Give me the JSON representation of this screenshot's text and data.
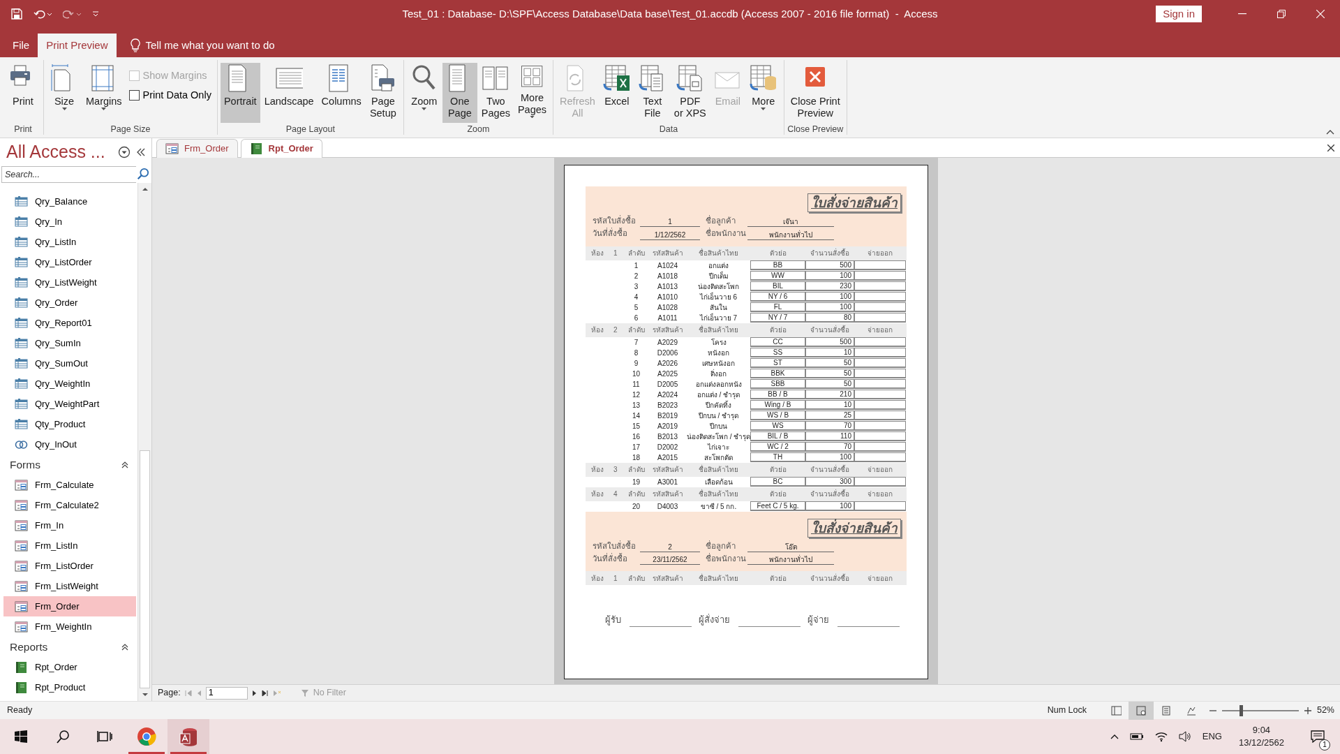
{
  "title_bar": {
    "title": "Test_01 : Database- D:\\SPF\\Access Database\\Data base\\Test_01.accdb (Access 2007 - 2016 file format)  -  Access",
    "sign_in": "Sign in"
  },
  "menu_tabs": [
    {
      "label": "File",
      "selected": false
    },
    {
      "label": "Print Preview",
      "selected": true
    }
  ],
  "tell_me": "Tell me what you want to do",
  "ribbon": {
    "groups": [
      {
        "label": "Print",
        "controls": [
          {
            "kind": "large",
            "label": "Print",
            "dropdown": false,
            "selected": false,
            "disabled": false
          }
        ]
      },
      {
        "label": "Page Size",
        "controls": [
          {
            "kind": "large",
            "label": "Size",
            "dropdown": true,
            "selected": false,
            "disabled": false
          },
          {
            "kind": "large",
            "label": "Margins",
            "dropdown": true,
            "selected": false,
            "disabled": false
          },
          {
            "kind": "check",
            "label": "Show Margins",
            "checked": false,
            "disabled": true
          },
          {
            "kind": "check",
            "label": "Print Data Only",
            "checked": false,
            "disabled": false
          }
        ]
      },
      {
        "label": "Page Layout",
        "controls": [
          {
            "kind": "large",
            "label": "Portrait",
            "dropdown": false,
            "selected": true,
            "disabled": false
          },
          {
            "kind": "large",
            "label": "Landscape",
            "dropdown": false,
            "selected": false,
            "disabled": false
          },
          {
            "kind": "large",
            "label": "Columns",
            "dropdown": false,
            "selected": false,
            "disabled": false
          },
          {
            "kind": "large",
            "label": "Page\nSetup",
            "dropdown": false,
            "selected": false,
            "disabled": false
          }
        ]
      },
      {
        "label": "Zoom",
        "controls": [
          {
            "kind": "large",
            "label": "Zoom",
            "dropdown": true,
            "selected": false,
            "disabled": false
          },
          {
            "kind": "large",
            "label": "One\nPage",
            "dropdown": false,
            "selected": true,
            "disabled": false
          },
          {
            "kind": "large",
            "label": "Two\nPages",
            "dropdown": false,
            "selected": false,
            "disabled": false
          },
          {
            "kind": "large",
            "label": "More\nPages",
            "dropdown": true,
            "selected": false,
            "disabled": false
          }
        ]
      },
      {
        "label": "Data",
        "controls": [
          {
            "kind": "large",
            "label": "Refresh\nAll",
            "dropdown": false,
            "selected": false,
            "disabled": true
          },
          {
            "kind": "large",
            "label": "Excel",
            "dropdown": false,
            "selected": false,
            "disabled": false
          },
          {
            "kind": "large",
            "label": "Text\nFile",
            "dropdown": false,
            "selected": false,
            "disabled": false
          },
          {
            "kind": "large",
            "label": "PDF\nor XPS",
            "dropdown": false,
            "selected": false,
            "disabled": false
          },
          {
            "kind": "large",
            "label": "Email",
            "dropdown": false,
            "selected": false,
            "disabled": true
          },
          {
            "kind": "large",
            "label": "More",
            "dropdown": true,
            "selected": false,
            "disabled": false
          }
        ]
      },
      {
        "label": "Close Preview",
        "controls": [
          {
            "kind": "large",
            "label": "Close Print\nPreview",
            "dropdown": false,
            "selected": false,
            "disabled": false
          }
        ]
      }
    ]
  },
  "nav_pane": {
    "title": "All Access ...",
    "search_placeholder": "Search...",
    "sections": [
      {
        "items": [
          {
            "label": "Qry_Balance",
            "kind": "query",
            "selected": false
          },
          {
            "label": "Qry_In",
            "kind": "query",
            "selected": false
          },
          {
            "label": "Qry_ListIn",
            "kind": "query",
            "selected": false
          },
          {
            "label": "Qry_ListOrder",
            "kind": "query",
            "selected": false
          },
          {
            "label": "Qry_ListWeight",
            "kind": "query",
            "selected": false
          },
          {
            "label": "Qry_Order",
            "kind": "query",
            "selected": false
          },
          {
            "label": "Qry_Report01",
            "kind": "query",
            "selected": false
          },
          {
            "label": "Qry_SumIn",
            "kind": "query",
            "selected": false
          },
          {
            "label": "Qry_SumOut",
            "kind": "query",
            "selected": false
          },
          {
            "label": "Qry_WeightIn",
            "kind": "query",
            "selected": false
          },
          {
            "label": "Qry_WeightPart",
            "kind": "query",
            "selected": false
          },
          {
            "label": "Qty_Product",
            "kind": "query",
            "selected": false
          },
          {
            "label": "Qry_InOut",
            "kind": "union",
            "selected": false
          }
        ]
      },
      {
        "header": "Forms",
        "items": [
          {
            "label": "Frm_Calculate",
            "kind": "form",
            "selected": false
          },
          {
            "label": "Frm_Calculate2",
            "kind": "form",
            "selected": false
          },
          {
            "label": "Frm_In",
            "kind": "form",
            "selected": false
          },
          {
            "label": "Frm_ListIn",
            "kind": "form",
            "selected": false
          },
          {
            "label": "Frm_ListOrder",
            "kind": "form",
            "selected": false
          },
          {
            "label": "Frm_ListWeight",
            "kind": "form",
            "selected": false
          },
          {
            "label": "Frm_Order",
            "kind": "form",
            "selected": true
          },
          {
            "label": "Frm_WeightIn",
            "kind": "form",
            "selected": false
          }
        ]
      },
      {
        "header": "Reports",
        "items": [
          {
            "label": "Rpt_Order",
            "kind": "report",
            "selected": false
          },
          {
            "label": "Rpt_Product",
            "kind": "report",
            "selected": false
          }
        ]
      }
    ]
  },
  "doc_tabs": [
    {
      "label": "Frm_Order",
      "kind": "form",
      "selected": false
    },
    {
      "label": "Rpt_Order",
      "kind": "report",
      "selected": true
    }
  ],
  "report": {
    "orders": [
      {
        "title": "ใบสั่งจ่ายสินค้า",
        "fields": [
          {
            "label": "รหัสใบสั่งซื้อ",
            "value": "1"
          },
          {
            "label": "ชื่อลูกค้า",
            "value": "เจ๊นา"
          },
          {
            "label": "วันที่สั่งซื้อ",
            "value": "1/12/2562"
          },
          {
            "label": "ชื่อพนักงาน",
            "value": "พนักงานทั่วไป"
          }
        ],
        "rooms": [
          {
            "label": "ห้อง",
            "number": "1",
            "columns": [
              "ลำดับ",
              "รหัสสินค้า",
              "ชื่อสินค้าไทย",
              "ตัวย่อ",
              "จำนวนสั่งซื้อ",
              "จ่ายออก"
            ],
            "rows": [
              {
                "no": "1",
                "code": "A1024",
                "name": "อกแต่ง",
                "abbr": "BB",
                "qty": "500"
              },
              {
                "no": "2",
                "code": "A1018",
                "name": "ปีกเต็ม",
                "abbr": "WW",
                "qty": "100"
              },
              {
                "no": "3",
                "code": "A1013",
                "name": "น่องติดสะโพก",
                "abbr": "BIL",
                "qty": "230"
              },
              {
                "no": "4",
                "code": "A1010",
                "name": "ไก่เอ็นวาย 6",
                "abbr": "NY / 6",
                "qty": "100"
              },
              {
                "no": "5",
                "code": "A1028",
                "name": "สันใน",
                "abbr": "FL",
                "qty": "100"
              },
              {
                "no": "6",
                "code": "A1011",
                "name": "ไก่เอ็นวาย 7",
                "abbr": "NY / 7",
                "qty": "80"
              }
            ]
          },
          {
            "label": "ห้อง",
            "number": "2",
            "columns": [
              "ลำดับ",
              "รหัสสินค้า",
              "ชื่อสินค้าไทย",
              "ตัวย่อ",
              "จำนวนสั่งซื้อ",
              "จ่ายออก"
            ],
            "rows": [
              {
                "no": "7",
                "code": "A2029",
                "name": "โครง",
                "abbr": "CC",
                "qty": "500"
              },
              {
                "no": "8",
                "code": "D2006",
                "name": "หนังอก",
                "abbr": "SS",
                "qty": "10"
              },
              {
                "no": "9",
                "code": "A2026",
                "name": "เศษหนังอก",
                "abbr": "ST",
                "qty": "50"
              },
              {
                "no": "10",
                "code": "A2025",
                "name": "ติ่งอก",
                "abbr": "BBK",
                "qty": "50"
              },
              {
                "no": "11",
                "code": "D2005",
                "name": "อกแต่งลอกหนัง",
                "abbr": "SBB",
                "qty": "50"
              },
              {
                "no": "12",
                "code": "A2024",
                "name": "อกแต่ง / ชำรุด",
                "abbr": "BB / B",
                "qty": "210"
              },
              {
                "no": "13",
                "code": "B2023",
                "name": "ปีกคัดทิ้ง",
                "abbr": "Wing / B",
                "qty": "10"
              },
              {
                "no": "14",
                "code": "B2019",
                "name": "ปีกบน / ชำรุด",
                "abbr": "WS / B",
                "qty": "25"
              },
              {
                "no": "15",
                "code": "A2019",
                "name": "ปีกบน",
                "abbr": "WS",
                "qty": "70"
              },
              {
                "no": "16",
                "code": "B2013",
                "name": "น่องติดสะโพก / ชำรุด",
                "abbr": "BIL / B",
                "qty": "110"
              },
              {
                "no": "17",
                "code": "D2002",
                "name": "ไก่เจาะ",
                "abbr": "WC / 2",
                "qty": "70"
              },
              {
                "no": "18",
                "code": "A2015",
                "name": "สะโพกตัด",
                "abbr": "TH",
                "qty": "100"
              }
            ]
          },
          {
            "label": "ห้อง",
            "number": "3",
            "columns": [
              "ลำดับ",
              "รหัสสินค้า",
              "ชื่อสินค้าไทย",
              "ตัวย่อ",
              "จำนวนสั่งซื้อ",
              "จ่ายออก"
            ],
            "rows": [
              {
                "no": "19",
                "code": "A3001",
                "name": "เลือดก้อน",
                "abbr": "BC",
                "qty": "300"
              }
            ]
          },
          {
            "label": "ห้อง",
            "number": "4",
            "columns": [
              "ลำดับ",
              "รหัสสินค้า",
              "ชื่อสินค้าไทย",
              "ตัวย่อ",
              "จำนวนสั่งซื้อ",
              "จ่ายออก"
            ],
            "rows": [
              {
                "no": "20",
                "code": "D4003",
                "name": "ขาซี / 5 กก.",
                "abbr": "Feet C / 5 kg.",
                "qty": "100"
              }
            ]
          }
        ]
      },
      {
        "title": "ใบสั่งจ่ายสินค้า",
        "fields": [
          {
            "label": "รหัสใบสั่งซื้อ",
            "value": "2"
          },
          {
            "label": "ชื่อลูกค้า",
            "value": "โอ๊ต"
          },
          {
            "label": "วันที่สั่งซื้อ",
            "value": "23/11/2562"
          },
          {
            "label": "ชื่อพนักงาน",
            "value": "พนักงานทั่วไป"
          }
        ],
        "rooms": [
          {
            "label": "ห้อง",
            "number": "1",
            "columns": [
              "ลำดับ",
              "รหัสสินค้า",
              "ชื่อสินค้าไทย",
              "ตัวย่อ",
              "จำนวนสั่งซื้อ",
              "จ่ายออก"
            ]
          }
        ]
      }
    ],
    "signatures": [
      "ผู้รับ",
      "ผู้สั่งจ่าย",
      "ผู้จ่าย"
    ]
  },
  "page_nav": {
    "label": "Page:",
    "value": "1",
    "filter": "No Filter"
  },
  "status_bar": {
    "text": "Ready",
    "num_lock": "Num Lock",
    "views": [
      {
        "selected": false
      },
      {
        "selected": true
      },
      {
        "selected": false
      },
      {
        "selected": false
      }
    ],
    "zoom_slider": {
      "level": 0.25
    },
    "zoom": "52%"
  },
  "taskbar": {
    "apps": [
      {
        "kind": "browser",
        "selected": false
      },
      {
        "kind": "access",
        "selected": true
      }
    ],
    "language": "ENG",
    "time": "9:04",
    "date": "13/12/2562",
    "notifications": "1"
  }
}
